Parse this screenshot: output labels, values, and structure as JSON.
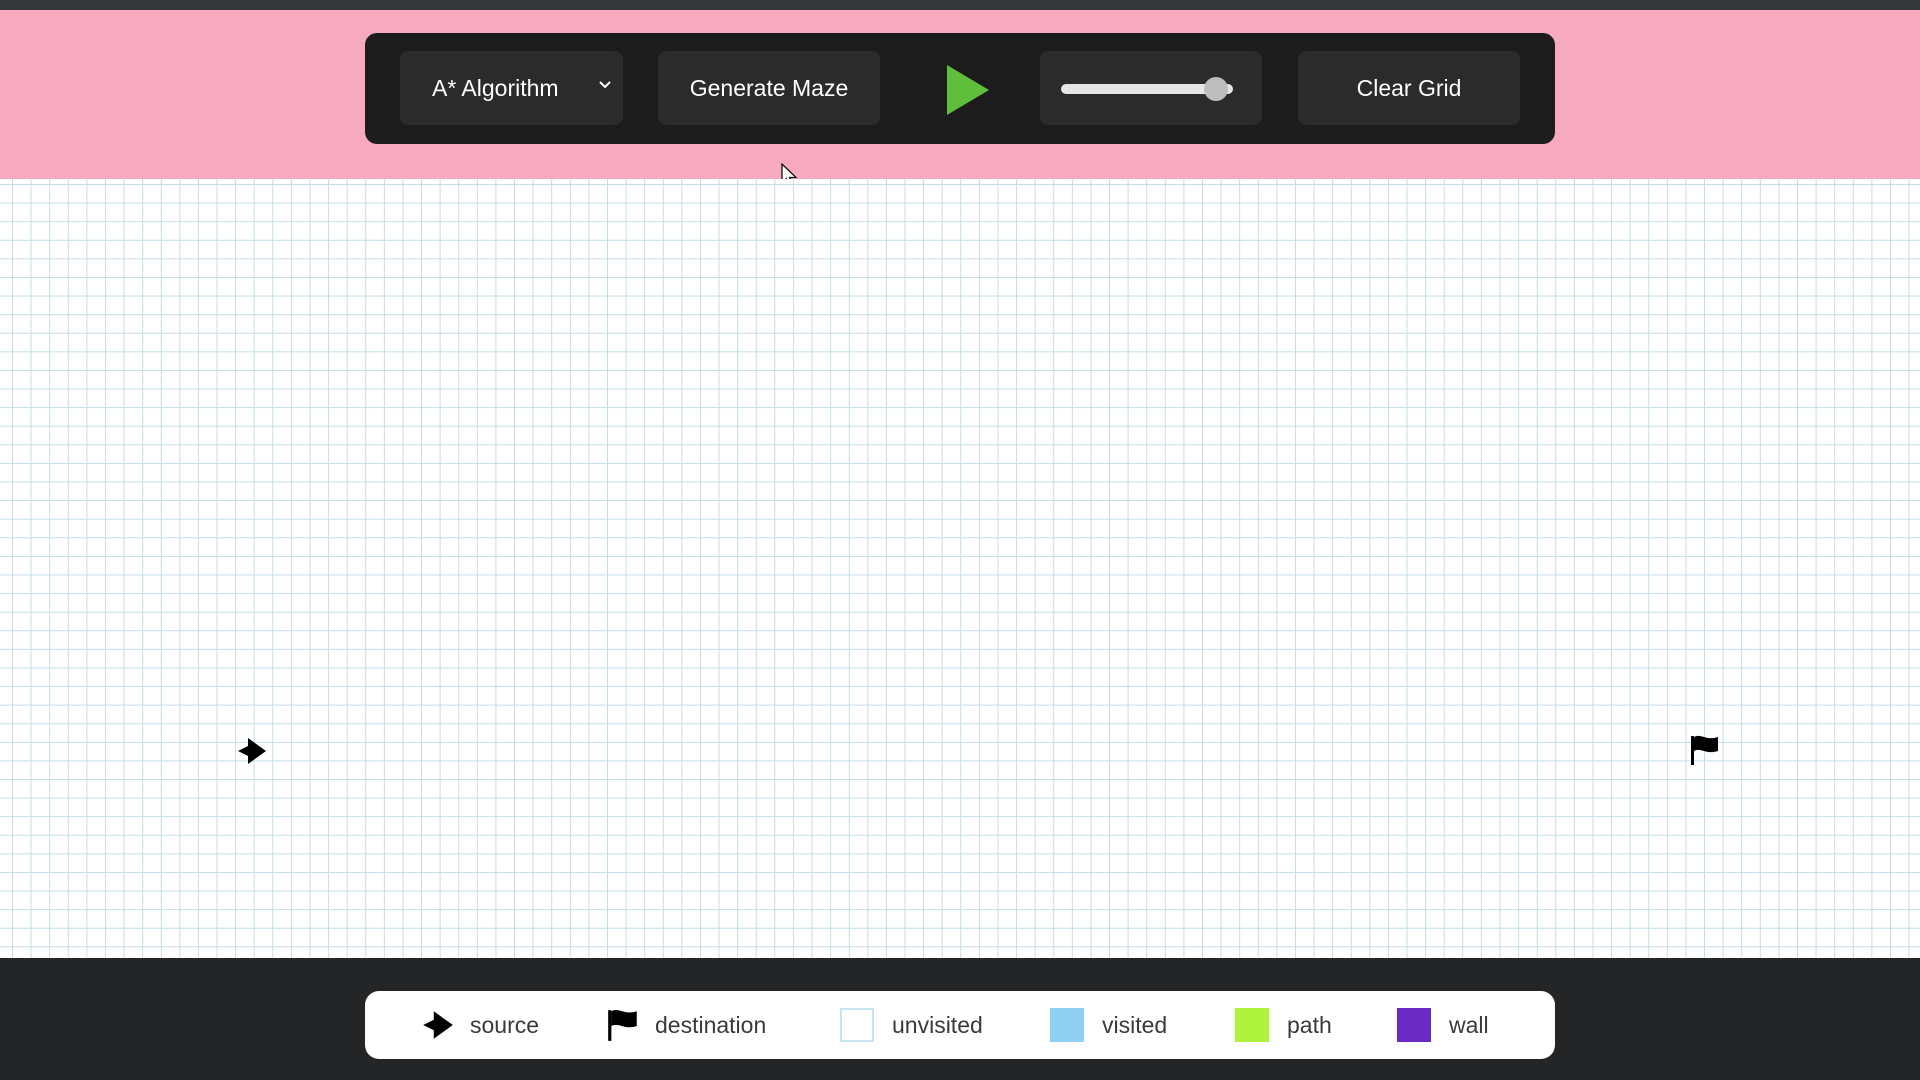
{
  "toolbar": {
    "algorithm_selected": "A* Algorithm",
    "generate_maze_label": "Generate Maze",
    "speed_value_percent": 90,
    "clear_grid_label": "Clear Grid"
  },
  "legend": {
    "items": [
      {
        "label": "source",
        "icon": "arrow-icon"
      },
      {
        "label": "destination",
        "icon": "flag-icon"
      },
      {
        "label": "unvisited",
        "color": "#ffffff"
      },
      {
        "label": "visited",
        "color": "#8fd0f2"
      },
      {
        "label": "path",
        "color": "#aef23c"
      },
      {
        "label": "wall",
        "color": "#6a2bc4"
      }
    ]
  },
  "colors": {
    "header_bg": "#f7a9bf",
    "toolbar_bg": "#1c1c1c",
    "play_green": "#5fbf3c",
    "grid_line": "#c3dde6"
  }
}
